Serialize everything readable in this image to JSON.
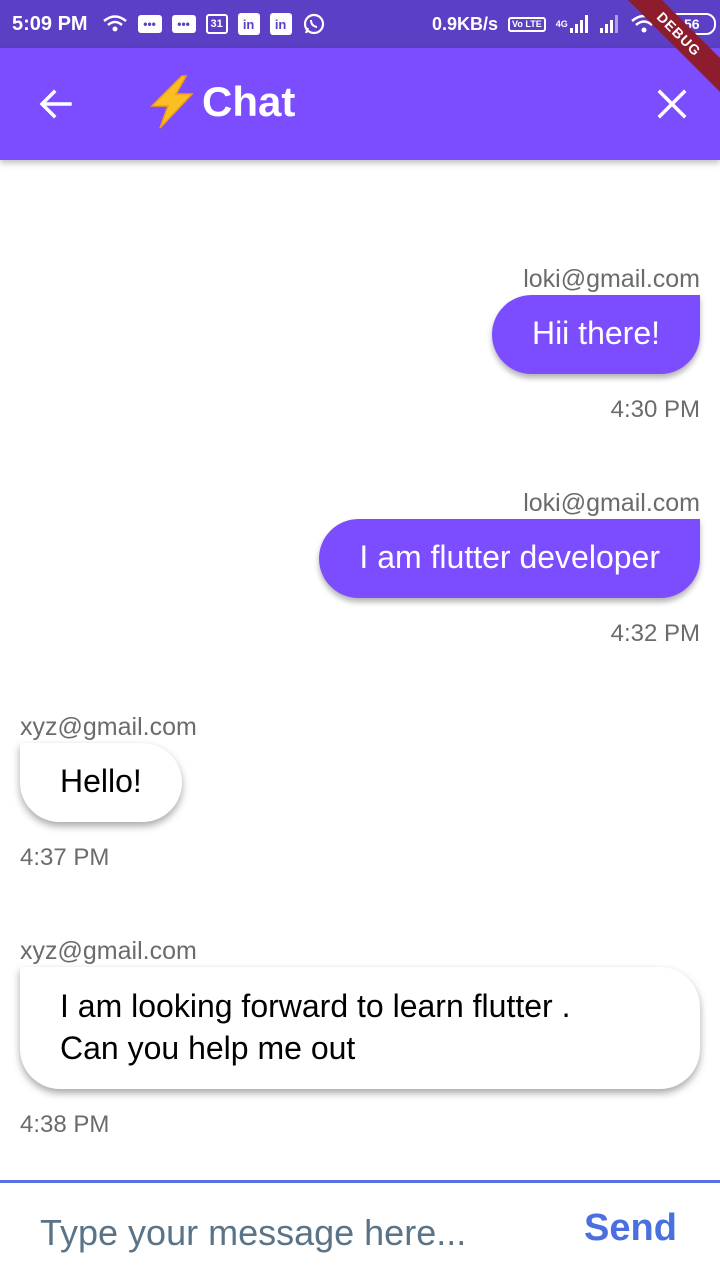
{
  "status_bar": {
    "time": "5:09 PM",
    "left_icons": [
      "wifi-data-icon",
      "message-icon",
      "message-icon",
      "calendar-icon",
      "linkedin-icon",
      "linkedin-icon",
      "whatsapp-icon"
    ],
    "calendar_day": "31",
    "linkedin_label": "in",
    "net_speed": "0.9KB/s",
    "volte": "Vo LTE",
    "network_type": "4G",
    "battery": "56"
  },
  "debug_banner": "DEBUG",
  "app_bar": {
    "title": "Chat",
    "title_icon": "lightning-bolt-icon",
    "back_icon": "arrow-back-icon",
    "close_icon": "close-icon",
    "background": "#7c4dff"
  },
  "messages": [
    {
      "sender": "loki@gmail.com",
      "text": "Hii there!",
      "time": "4:30 PM",
      "is_me": true
    },
    {
      "sender": "loki@gmail.com",
      "text": "I am flutter developer",
      "time": "4:32 PM",
      "is_me": true
    },
    {
      "sender": "xyz@gmail.com",
      "text": "Hello!",
      "time": "4:37 PM",
      "is_me": false
    },
    {
      "sender": "xyz@gmail.com",
      "text": "I am looking forward to learn flutter .\nCan you help me out",
      "time": "4:38 PM",
      "is_me": false
    }
  ],
  "composer": {
    "placeholder": "Type your message here...",
    "value": "",
    "send_label": "Send"
  },
  "colors": {
    "accent": "#7c4dff",
    "status_bar": "#5b3fc4",
    "send": "#4a6fe0"
  }
}
